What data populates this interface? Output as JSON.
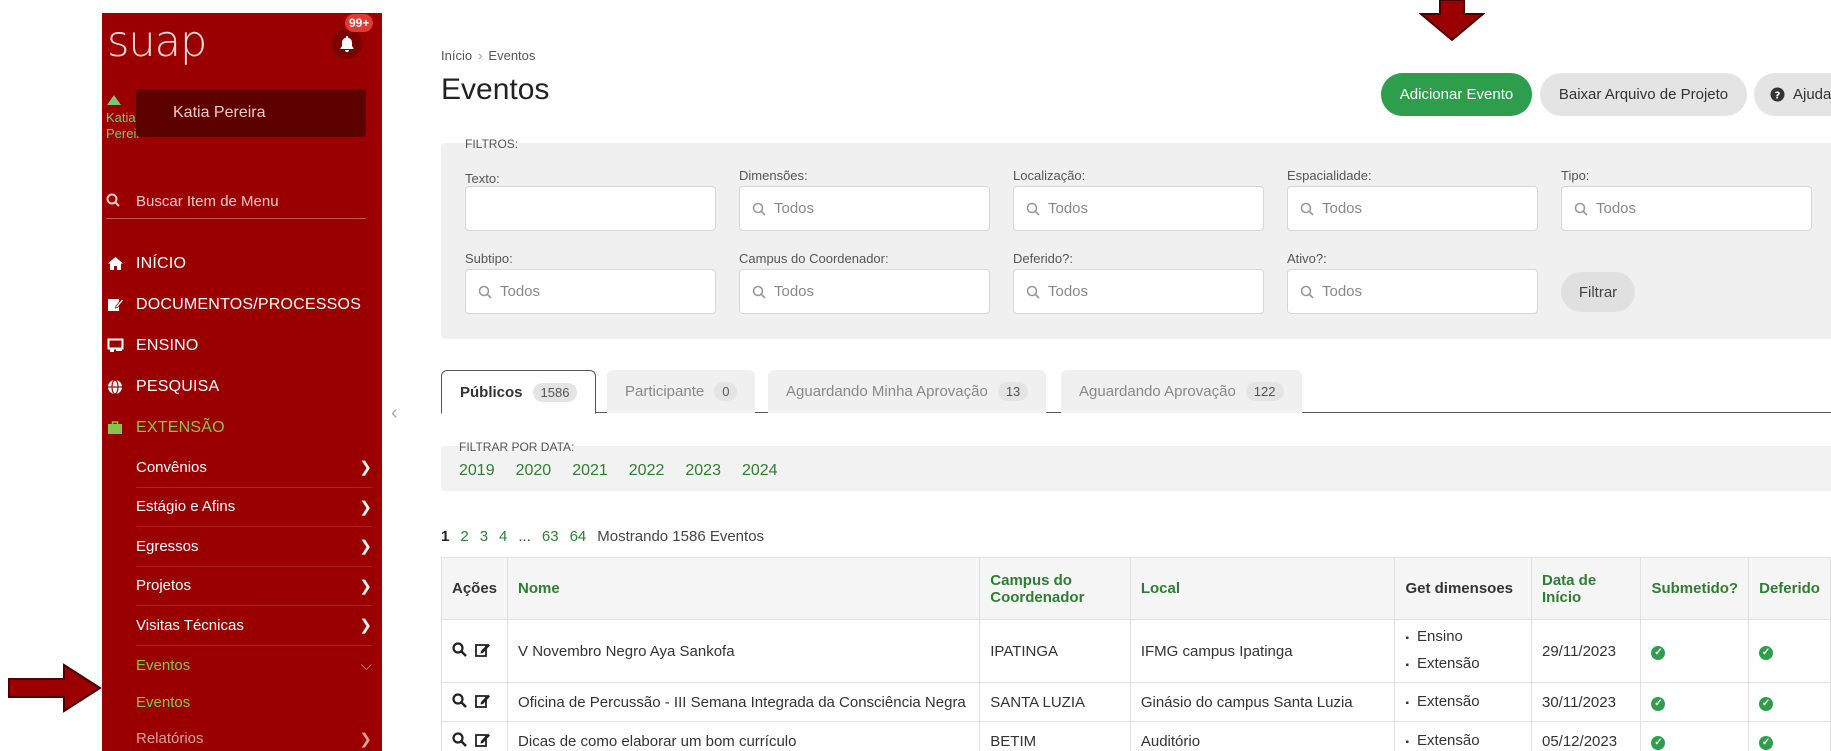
{
  "app": {
    "logo": "suap",
    "notifications": "99+"
  },
  "user": {
    "name": "Katia Pereira",
    "avatar_alt": "Katia Pereir"
  },
  "sidebar": {
    "search_placeholder": "Buscar Item de Menu",
    "items": [
      {
        "label": "INÍCIO",
        "icon": "home-icon"
      },
      {
        "label": "DOCUMENTOS/PROCESSOS",
        "icon": "document-edit-icon"
      },
      {
        "label": "ENSINO",
        "icon": "presentation-icon"
      },
      {
        "label": "PESQUISA",
        "icon": "globe-icon"
      },
      {
        "label": "EXTENSÃO",
        "icon": "briefcase-icon"
      }
    ],
    "submenu": [
      "Convênios",
      "Estágio e Afins",
      "Egressos",
      "Projetos",
      "Visitas Técnicas",
      "Eventos"
    ],
    "subsub": "Eventos",
    "last": "Relatórios"
  },
  "breadcrumb": {
    "home": "Início",
    "current": "Eventos"
  },
  "page_title": "Eventos",
  "actions": {
    "add": "Adicionar Evento",
    "download": "Baixar Arquivo de Projeto",
    "help": "Ajuda"
  },
  "filters": {
    "header": "FILTROS:",
    "texto": "Texto:",
    "dimensoes": "Dimensões:",
    "localizacao": "Localização:",
    "espacialidade": "Espacialidade:",
    "tipo": "Tipo:",
    "subtipo": "Subtipo:",
    "campus": "Campus do Coordenador:",
    "deferido": "Deferido?:",
    "ativo": "Ativo?:",
    "todos": "Todos",
    "button": "Filtrar"
  },
  "tabs": [
    {
      "label": "Públicos",
      "count": "1586"
    },
    {
      "label": "Participante",
      "count": "0"
    },
    {
      "label": "Aguardando Minha Aprovação",
      "count": "13"
    },
    {
      "label": "Aguardando Aprovação",
      "count": "122"
    }
  ],
  "date_filter": {
    "label": "FILTRAR POR DATA:",
    "years": [
      "2019",
      "2020",
      "2021",
      "2022",
      "2023",
      "2024"
    ]
  },
  "pagination": {
    "pages": [
      "1",
      "2",
      "3",
      "4",
      "...",
      "63",
      "64"
    ],
    "summary": "Mostrando 1586 Eventos"
  },
  "table": {
    "headers": [
      "Ações",
      "Nome",
      "Campus do Coordenador",
      "Local",
      "Get dimensoes",
      "Data de Início",
      "Submetido?",
      "Deferido"
    ],
    "rows": [
      {
        "nome": "V Novembro Negro Aya Sankofa",
        "campus": "IPATINGA",
        "local": "IFMG campus Ipatinga",
        "dims": [
          "Ensino",
          "Extensão"
        ],
        "data": "29/11/2023"
      },
      {
        "nome": "Oficina de Percussão - III Semana Integrada da Consciência Negra",
        "campus": "SANTA LUZIA",
        "local": "Ginásio do campus Santa Luzia",
        "dims": [
          "Extensão"
        ],
        "data": "30/11/2023"
      },
      {
        "nome": "Dicas de como elaborar um bom currículo",
        "campus": "BETIM",
        "local": "Auditório",
        "dims": [
          "Extensão"
        ],
        "data": "05/12/2023"
      }
    ]
  },
  "colors": {
    "sidebar": "#9b0000",
    "accent_green": "#2e9e4c",
    "arrow": "#9b0000"
  }
}
